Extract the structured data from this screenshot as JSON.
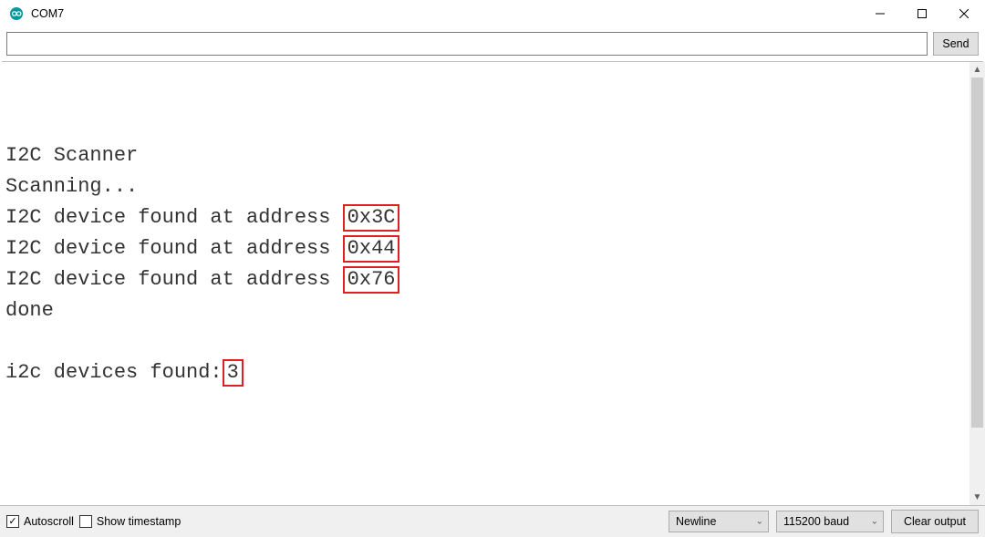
{
  "window": {
    "title": "COM7"
  },
  "input": {
    "value": "",
    "send_label": "Send"
  },
  "output": {
    "blank1": " ",
    "l1": "I2C Scanner",
    "l2": "Scanning...",
    "l3pre": "I2C device found at address ",
    "l3box": "0x3C",
    "l4pre": "I2C device found at address ",
    "l4box": "0x44",
    "l5pre": "I2C device found at address ",
    "l5box": "0x76",
    "l6": "done",
    "blank2": " ",
    "l7pre": "i2c devices found:",
    "l7box": "3"
  },
  "bottom": {
    "autoscroll_label": "Autoscroll",
    "timestamp_label": "Show timestamp",
    "line_ending": "Newline",
    "baud": "115200 baud",
    "clear_label": "Clear output"
  }
}
